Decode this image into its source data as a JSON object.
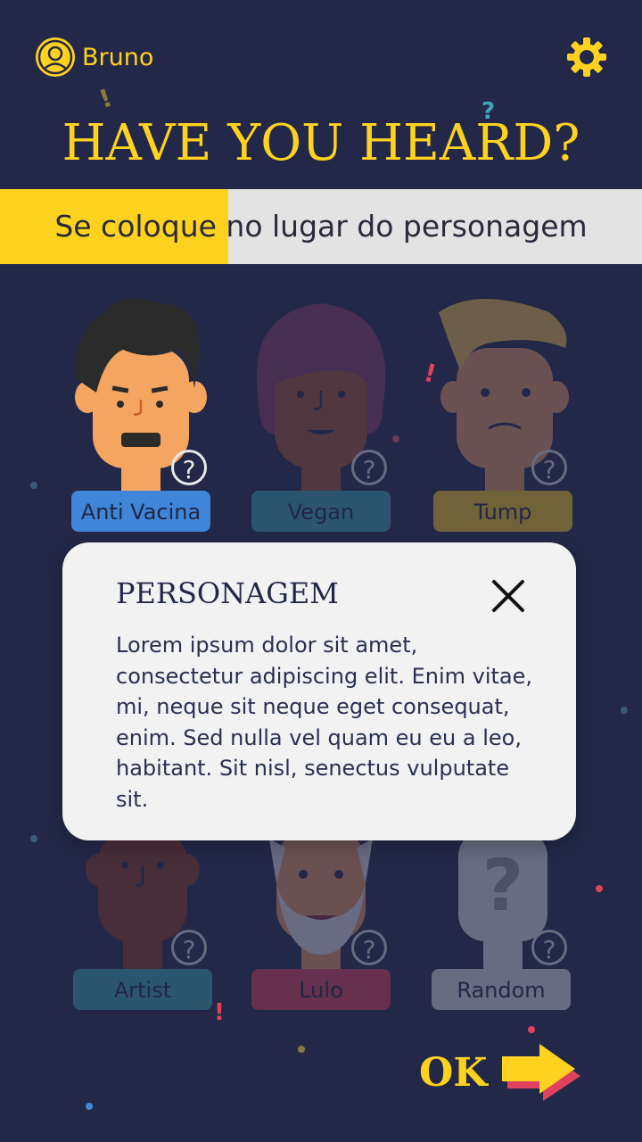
{
  "header": {
    "user_name": "Bruno",
    "title": "HAVE YOU HEARD?"
  },
  "instruction": {
    "text": "Se coloque no lugar do personagem",
    "progress": 0.355
  },
  "characters": [
    {
      "label": "Anti Vacina",
      "color": "#3F86D9",
      "selected": true
    },
    {
      "label": "Vegan",
      "color": "#3BA8B8",
      "selected": false
    },
    {
      "label": "Tump",
      "color": "#FFD21F",
      "selected": false
    },
    {
      "label": "Artist",
      "color": "#3BA8B8",
      "selected": false
    },
    {
      "label": "Lulo",
      "color": "#E0425E",
      "selected": false
    },
    {
      "label": "Random",
      "color": "#E8E8EC",
      "selected": false
    }
  ],
  "help_glyph": "?",
  "modal": {
    "title": "PERSONAGEM",
    "body": "Lorem ipsum dolor sit amet, consectetur adipiscing elit. Enim vitae, mi, neque sit neque eget consequat, enim. Sed nulla vel quam eu eu a leo, habitant. Sit nisl, senectus vulputate sit."
  },
  "ok": {
    "label": "OK"
  },
  "colors": {
    "background": "#232848",
    "accent": "#FFD21F",
    "panel": "#F2F2F3"
  }
}
